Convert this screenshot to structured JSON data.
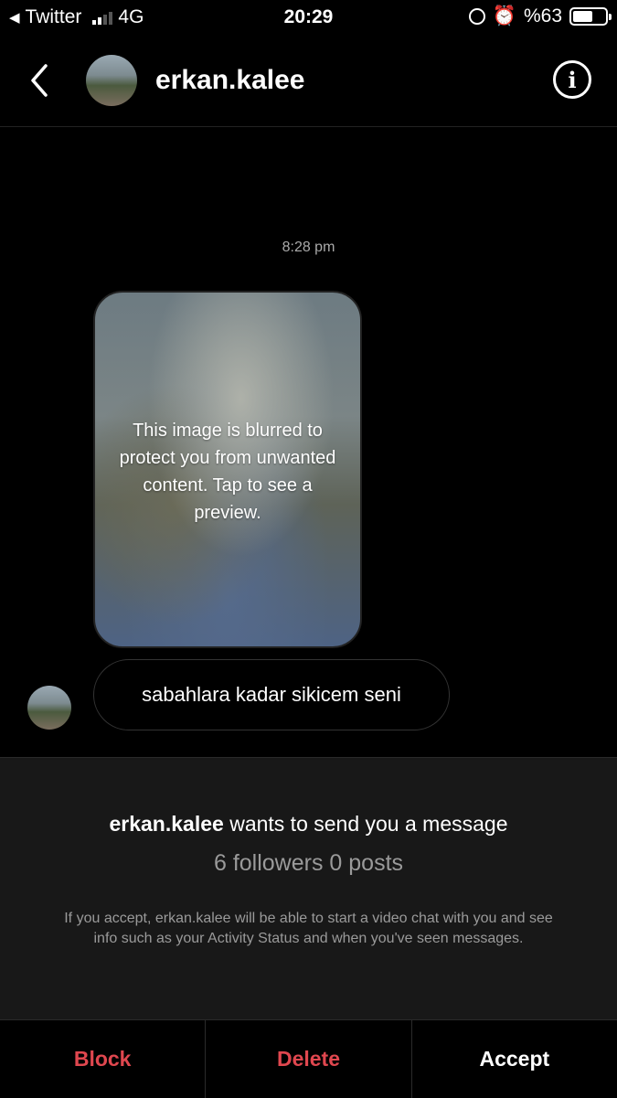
{
  "status": {
    "back_app": "Twitter",
    "network": "4G",
    "time": "20:29",
    "battery": "%63",
    "battery_level": 0.63
  },
  "header": {
    "username": "erkan.kalee",
    "info_glyph": "i"
  },
  "chat": {
    "timestamp": "8:28 pm",
    "blur_notice": "This image is blurred to protect you from unwanted content. Tap to see a preview.",
    "message": "sabahlara kadar sikicem seni"
  },
  "request": {
    "username": "erkan.kalee",
    "wants_text": " wants to send you a message",
    "stats": "6 followers 0 posts",
    "note": "If you accept, erkan.kalee will be able to start a video chat with you and see info such as your Activity Status and when you've seen messages."
  },
  "actions": {
    "block": "Block",
    "delete": "Delete",
    "accept": "Accept"
  },
  "colors": {
    "danger": "#e0474f",
    "background": "#000000",
    "panel": "#181818"
  }
}
